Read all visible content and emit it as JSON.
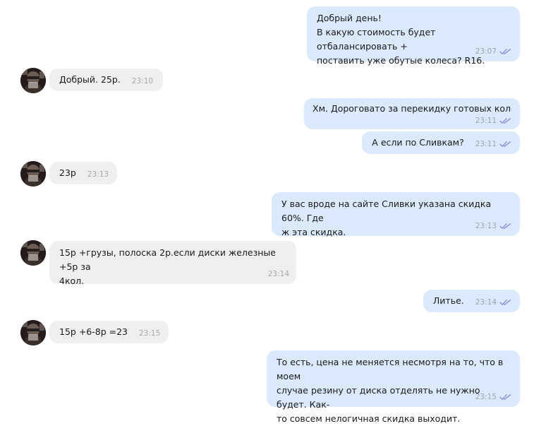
{
  "messages": [
    {
      "lines": [
        "Добрый день!",
        "В какую стоимость будет отбалансировать +",
        "поставить уже обутые колеса? R16."
      ],
      "time": "23:07"
    },
    {
      "text": "Добрый. 25р.",
      "time": "23:10"
    },
    {
      "text": "Хм. Дороговато за перекидку готовых колес...",
      "time": "23:11"
    },
    {
      "text": "А если по Сливкам?",
      "time": "23:11"
    },
    {
      "text": "23р",
      "time": "23:13"
    },
    {
      "lines": [
        "У вас вроде на сайте Сливки указана скидка 60%. Где",
        "ж эта скидка."
      ],
      "time": "23:13"
    },
    {
      "lines": [
        "15р +грузы, полоска 2р.если диски железные +5р за",
        "4кол."
      ],
      "time": "23:14"
    },
    {
      "text": "Литье.",
      "time": "23:14"
    },
    {
      "text": "15р +6-8р =23",
      "time": "23:15"
    },
    {
      "lines": [
        "То есть, цена не меняется несмотря на то, что в моем",
        "случае резину от диска отделять не нужно будет. Как-",
        "то совсем нелогичная скидка выходит."
      ],
      "time": "23:15"
    }
  ],
  "icons": {
    "read_ticks": "double-check-icon",
    "avatar": "contact-avatar"
  },
  "colors": {
    "outgoing_bubble": "#dbe9fc",
    "incoming_bubble": "#efefef",
    "read_ticks": "#8a8fd6"
  }
}
